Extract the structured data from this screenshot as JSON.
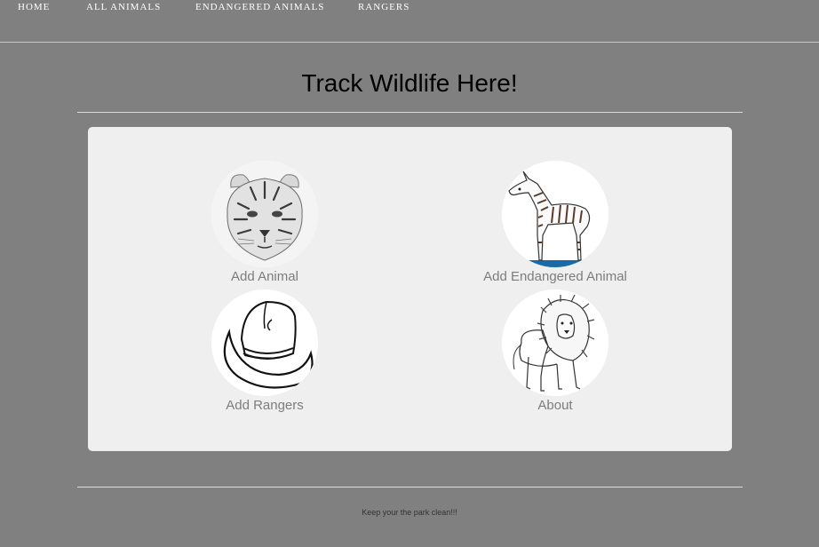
{
  "nav": {
    "home": "HOME",
    "all_animals": "ALL ANIMALS",
    "endangered_animals": "ENDANGERED ANIMALS",
    "rangers": "RANGERS"
  },
  "page_title": "Track Wildlife Here!",
  "tiles": {
    "add_animal": {
      "label": "Add Animal",
      "icon": "tiger-icon"
    },
    "add_endangered": {
      "label": "Add Endangered Animal",
      "icon": "zebra-icon"
    },
    "add_rangers": {
      "label": "Add Rangers",
      "icon": "cowboy-hat-icon"
    },
    "about": {
      "label": "About",
      "icon": "lion-icon"
    }
  },
  "footer": {
    "text": "Keep your the park clean!!!"
  },
  "colors": {
    "background": "#808080",
    "panel": "#efefef",
    "label": "#7d7d7d"
  }
}
